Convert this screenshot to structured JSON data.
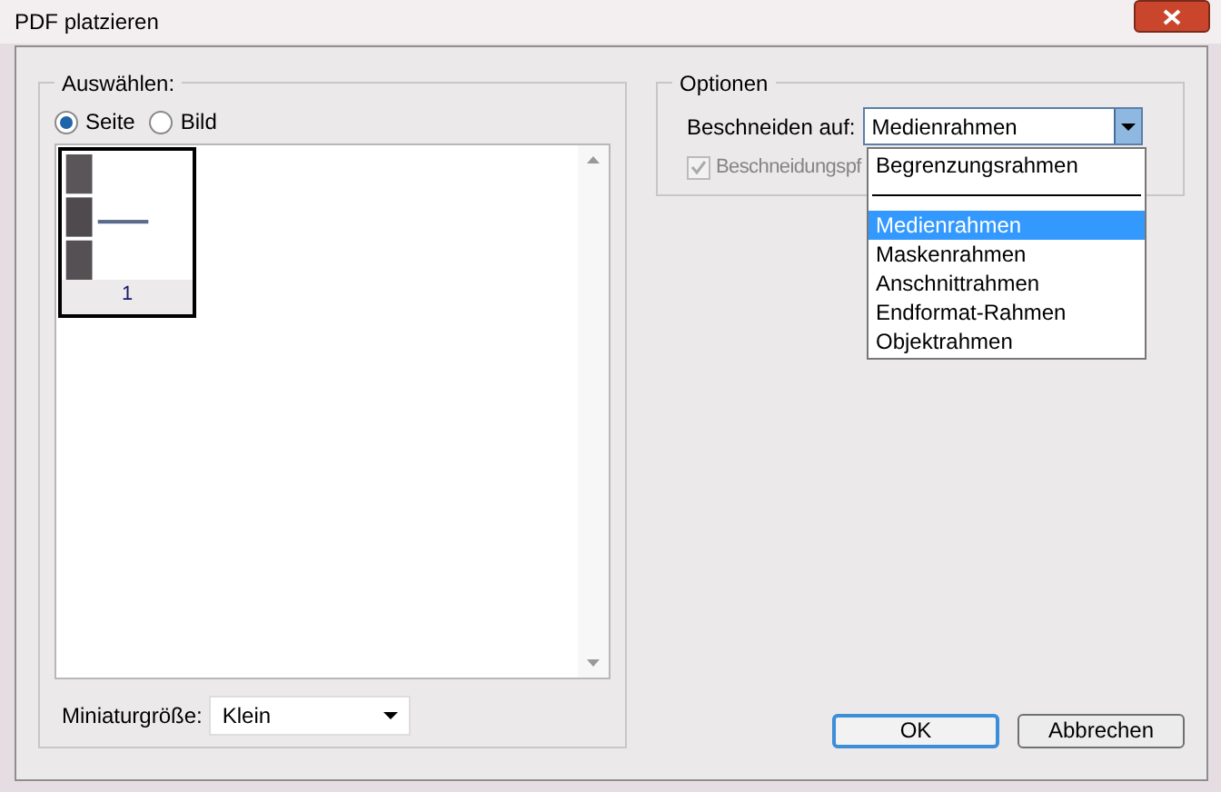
{
  "window": {
    "title": "PDF platzieren"
  },
  "select_group": {
    "title": "Auswählen:",
    "options": [
      {
        "label": "Seite",
        "selected": true
      },
      {
        "label": "Bild",
        "selected": false
      }
    ],
    "thumbnails": [
      {
        "label": "1",
        "selected": true
      }
    ],
    "thumbnail_size": {
      "label": "Miniaturgröße:",
      "value": "Klein"
    }
  },
  "options_group": {
    "title": "Optionen",
    "crop_label": "Beschneiden auf:",
    "crop_value": "Medienrahmen",
    "checkbox": {
      "label": "Beschneidungspf",
      "checked": true,
      "disabled": true
    },
    "dropdown_items": [
      {
        "kind": "item",
        "label": "Begrenzungsrahmen",
        "selected": false
      },
      {
        "kind": "separator"
      },
      {
        "kind": "item",
        "label": "Medienrahmen",
        "selected": true
      },
      {
        "kind": "item",
        "label": "Maskenrahmen",
        "selected": false
      },
      {
        "kind": "item",
        "label": "Anschnittrahmen",
        "selected": false
      },
      {
        "kind": "item",
        "label": "Endformat-Rahmen",
        "selected": false
      },
      {
        "kind": "item",
        "label": "Objektrahmen",
        "selected": false
      }
    ]
  },
  "buttons": [
    {
      "label": "OK",
      "default": true
    },
    {
      "label": "Abbrechen",
      "default": false
    }
  ]
}
